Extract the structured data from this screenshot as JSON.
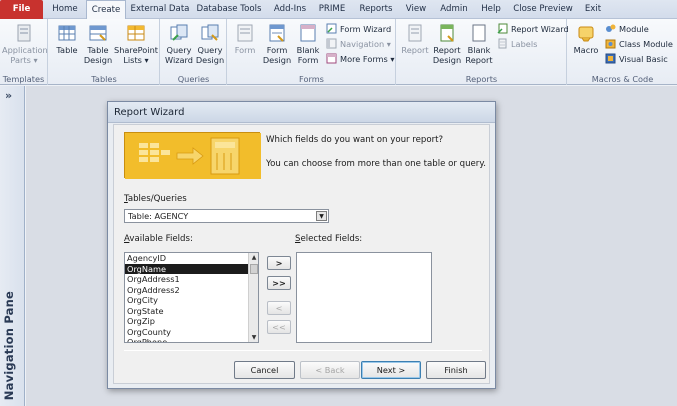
{
  "ribbon_tabs": [
    "File",
    "Home",
    "Create",
    "External Data",
    "Database Tools",
    "Add-Ins",
    "PRIME",
    "Reports",
    "View",
    "Admin",
    "Help",
    "Close Preview",
    "Exit"
  ],
  "active_tab": "Create",
  "groups": {
    "templates": {
      "label": "Templates",
      "app_parts": "Application Parts ▾"
    },
    "tables": {
      "label": "Tables",
      "table": "Table",
      "table_design": "Table Design",
      "sharepoint_lists": "SharePoint Lists ▾"
    },
    "queries": {
      "label": "Queries",
      "query_wizard": "Query Wizard",
      "query_design": "Query Design"
    },
    "forms": {
      "label": "Forms",
      "form": "Form",
      "form_design": "Form Design",
      "blank_form": "Blank Form",
      "form_wizard": "Form Wizard",
      "navigation": "Navigation ▾",
      "more_forms": "More Forms ▾"
    },
    "reports": {
      "label": "Reports",
      "report": "Report",
      "report_design": "Report Design",
      "blank_report": "Blank Report",
      "report_wizard": "Report Wizard",
      "labels": "Labels"
    },
    "macros": {
      "label": "Macros & Code",
      "macro": "Macro",
      "module": "Module",
      "class_module": "Class Module",
      "visual_basic": "Visual Basic"
    }
  },
  "nav_pane": {
    "toggle": "»",
    "label": "Navigation Pane"
  },
  "wizard": {
    "title": "Report Wizard",
    "prompt1": "Which fields do you want on your report?",
    "prompt2": "You can choose from more than one table or query.",
    "tables_label_u": "T",
    "tables_label_rest": "ables/Queries",
    "table_selected": "Table: AGENCY",
    "available_label_u": "A",
    "available_label_rest": "vailable Fields:",
    "selected_label_u": "S",
    "selected_label_rest": "elected Fields:",
    "available_fields": [
      "AgencyID",
      "OrgName",
      "OrgAddress1",
      "OrgAddress2",
      "OrgCity",
      "OrgState",
      "OrgZip",
      "OrgCounty",
      "OrgPhone"
    ],
    "selected_field": "OrgName",
    "selected_fields": [],
    "btn_add_one": ">",
    "btn_add_all": ">>",
    "btn_remove_one": "<",
    "btn_remove_all": "<<",
    "cancel": "Cancel",
    "back": "< Back",
    "next": "Next >",
    "finish": "Finish"
  },
  "colors": {
    "file_tab": "#c8322e",
    "illustration": "#f2bd2b",
    "selection": "#1c1c1c"
  }
}
